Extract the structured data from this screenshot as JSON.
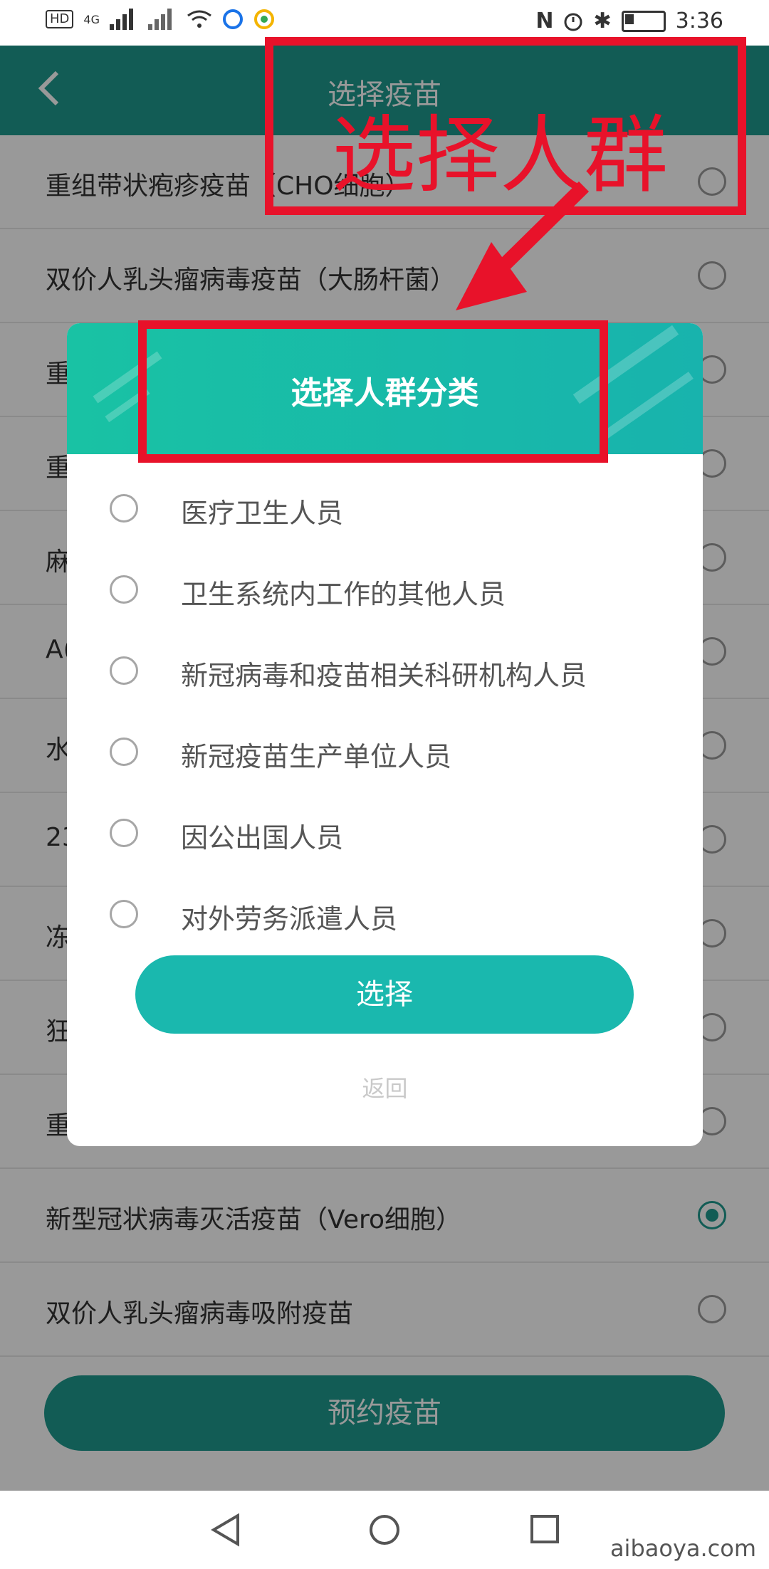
{
  "status_bar": {
    "left_icons": [
      "HD",
      "4G",
      "signal-bars",
      "signal-bars",
      "wifi-icon",
      "app-icon",
      "app-icon"
    ],
    "time": "3:36"
  },
  "header": {
    "title": "选择疫苗"
  },
  "list": {
    "items": [
      {
        "label": "重组带状疱疹疫苗（CHO细胞）",
        "selected": false
      },
      {
        "label": "双价人乳头瘤病毒疫苗（大肠杆菌）",
        "selected": false
      },
      {
        "label": "重",
        "selected": false
      },
      {
        "label": "重",
        "selected": false
      },
      {
        "label": "麻",
        "selected": false
      },
      {
        "label": "A(",
        "selected": false
      },
      {
        "label": "水",
        "selected": false
      },
      {
        "label": "23",
        "selected": false
      },
      {
        "label": "冻",
        "selected": false
      },
      {
        "label": "狂",
        "selected": false
      },
      {
        "label": "重",
        "selected": false
      },
      {
        "label": "新型冠状病毒灭活疫苗（Vero细胞）",
        "selected": true
      },
      {
        "label": "双价人乳头瘤病毒吸附疫苗",
        "selected": false
      }
    ]
  },
  "book_button": "预约疫苗",
  "modal": {
    "title": "选择人群分类",
    "options": [
      "医疗卫生人员",
      "卫生系统内工作的其他人员",
      "新冠病毒和疫苗相关科研机构人员",
      "新冠疫苗生产单位人员",
      "因公出国人员",
      "对外劳务派遣人员"
    ],
    "select_button": "选择",
    "return_link": "返回"
  },
  "annotation": {
    "text": "选择人群",
    "color": "#e8122a"
  },
  "watermark": "aibaoya.com",
  "colors": {
    "accent": "#1e9a8e",
    "modal_header": "#18b3ad",
    "annotation": "#e8122a"
  }
}
